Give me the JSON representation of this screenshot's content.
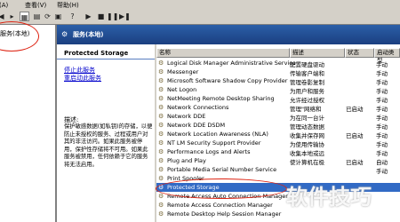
{
  "menu": {
    "items": [
      "作(A)",
      "查看(V)",
      "帮助(H)"
    ]
  },
  "toolbar": {
    "icons": [
      "back-icon",
      "forward-icon",
      "show-tree-icon",
      "properties-icon",
      "refresh-icon",
      "export-icon",
      "help-icon",
      "play-icon",
      "stop-icon",
      "pause-icon",
      "restart-icon"
    ]
  },
  "tree": {
    "root_label": "服务(本地)"
  },
  "header": {
    "title": "服务(本地)"
  },
  "detail": {
    "service_name": "Protected Storage",
    "stop_link": "停止此服务",
    "restart_link": "重启动此服务",
    "desc_label": "描述:",
    "desc_text": "保护敏感数据(如私钥)的存储，以便防止未授权的服务、过程或用户对其的非法访问。如果此服务被停用，保护性存储将不可用。如果此服务被禁用，任何依赖于它的服务将无法启用。"
  },
  "list": {
    "columns": [
      "名称",
      "描述",
      "状态",
      "启动类型"
    ],
    "rows": [
      {
        "name": "Logical Disk Manager Administrative Service",
        "desc": "配置硬盘驱动",
        "status": "",
        "start": "手动"
      },
      {
        "name": "Messenger",
        "desc": "传输客户端和",
        "status": "",
        "start": "手动"
      },
      {
        "name": "Microsoft Software Shadow Copy Provider",
        "desc": "管理卷影复制",
        "status": "",
        "start": "手动"
      },
      {
        "name": "Net Logon",
        "desc": "为用户和服务",
        "status": "",
        "start": "手动"
      },
      {
        "name": "NetMeeting Remote Desktop Sharing",
        "desc": "允许经过授权",
        "status": "",
        "start": "手动"
      },
      {
        "name": "Network Connections",
        "desc": "管理\"网络和",
        "status": "已启动",
        "start": "手动"
      },
      {
        "name": "Network DDE",
        "desc": "为在同一台计",
        "status": "",
        "start": "手动"
      },
      {
        "name": "Network DDE DSDM",
        "desc": "管理动态数据",
        "status": "",
        "start": "手动"
      },
      {
        "name": "Network Location Awareness (NLA)",
        "desc": "收集并保存网",
        "status": "已启动",
        "start": "手动"
      },
      {
        "name": "NT LM Security Support Provider",
        "desc": "为使用传输协",
        "status": "",
        "start": "手动"
      },
      {
        "name": "Performance Logs and Alerts",
        "desc": "收集本地或远",
        "status": "",
        "start": "手动"
      },
      {
        "name": "Plug and Play",
        "desc": "使计算机在极",
        "status": "已启动",
        "start": "自动"
      },
      {
        "name": "Portable Media Serial Number Service",
        "desc": "",
        "status": "",
        "start": "手动"
      },
      {
        "name": "Print Spooler",
        "desc": "",
        "status": "",
        "start": ""
      },
      {
        "name": "Protected Storage",
        "desc": "",
        "status": "",
        "start": ""
      },
      {
        "name": "Remote Access Auto Connection Manager",
        "desc": "",
        "status": "",
        "start": ""
      },
      {
        "name": "Remote Access Connection Manager",
        "desc": "",
        "status": "",
        "start": ""
      },
      {
        "name": "Remote Desktop Help Session Manager",
        "desc": "",
        "status": "",
        "start": ""
      }
    ]
  },
  "watermark": "软件技巧",
  "colors": {
    "header": "#1b3f80",
    "selection": "#316ac5",
    "annotation": "#dd2211"
  }
}
